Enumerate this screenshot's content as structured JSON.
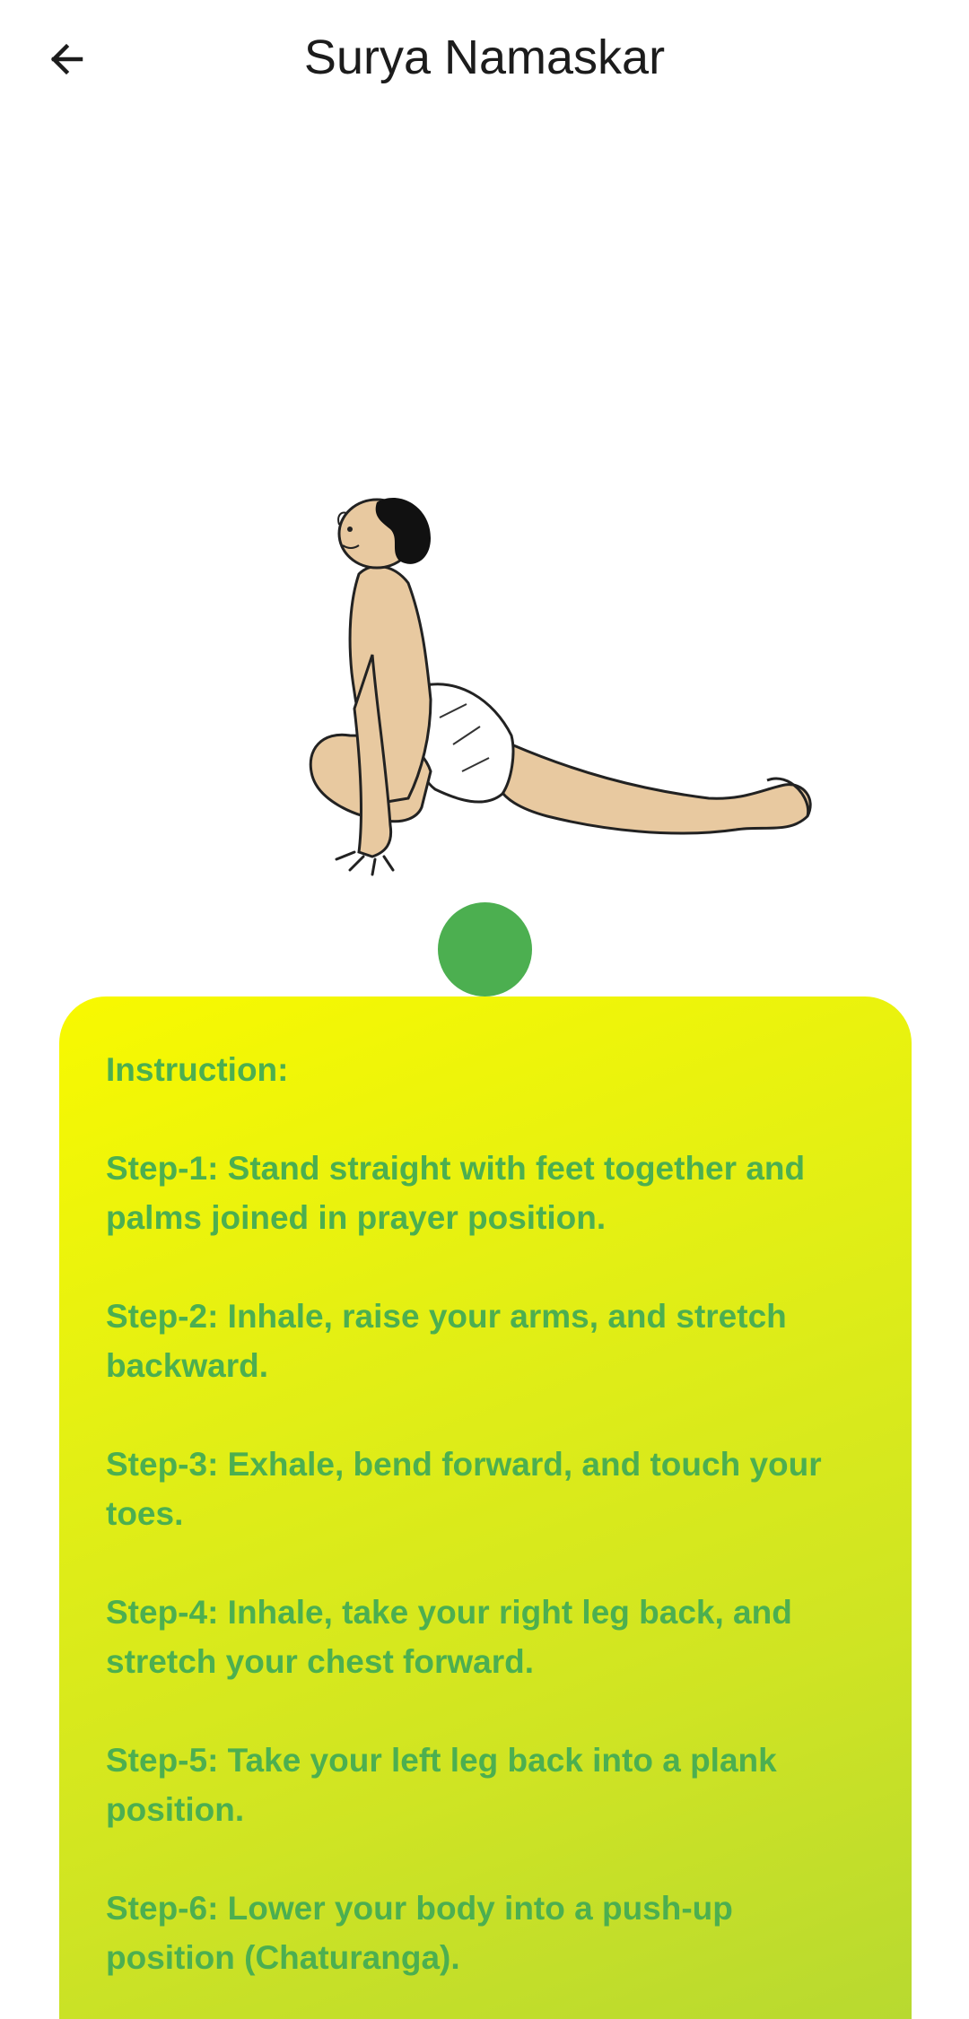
{
  "header": {
    "title": "Surya Namaskar",
    "back_icon": "arrow-back-icon"
  },
  "pose_image": {
    "icon": "yoga-lunge-pose-illustration"
  },
  "colors": {
    "accent_green": "#4caf50",
    "card_gradient_start": "#f8f900",
    "card_gradient_end": "#b8d930"
  },
  "instructions": {
    "heading": "Instruction:",
    "steps": [
      "Step-1: Stand straight with feet together and palms joined in prayer position.",
      "Step-2: Inhale, raise your arms, and stretch backward.",
      "Step-3: Exhale, bend forward, and touch your toes.",
      "Step-4: Inhale, take your right leg back, and stretch your chest forward.",
      "Step-5: Take your left leg back into a plank position.",
      "Step-6: Lower your body into a push-up position (Chaturanga)."
    ]
  }
}
